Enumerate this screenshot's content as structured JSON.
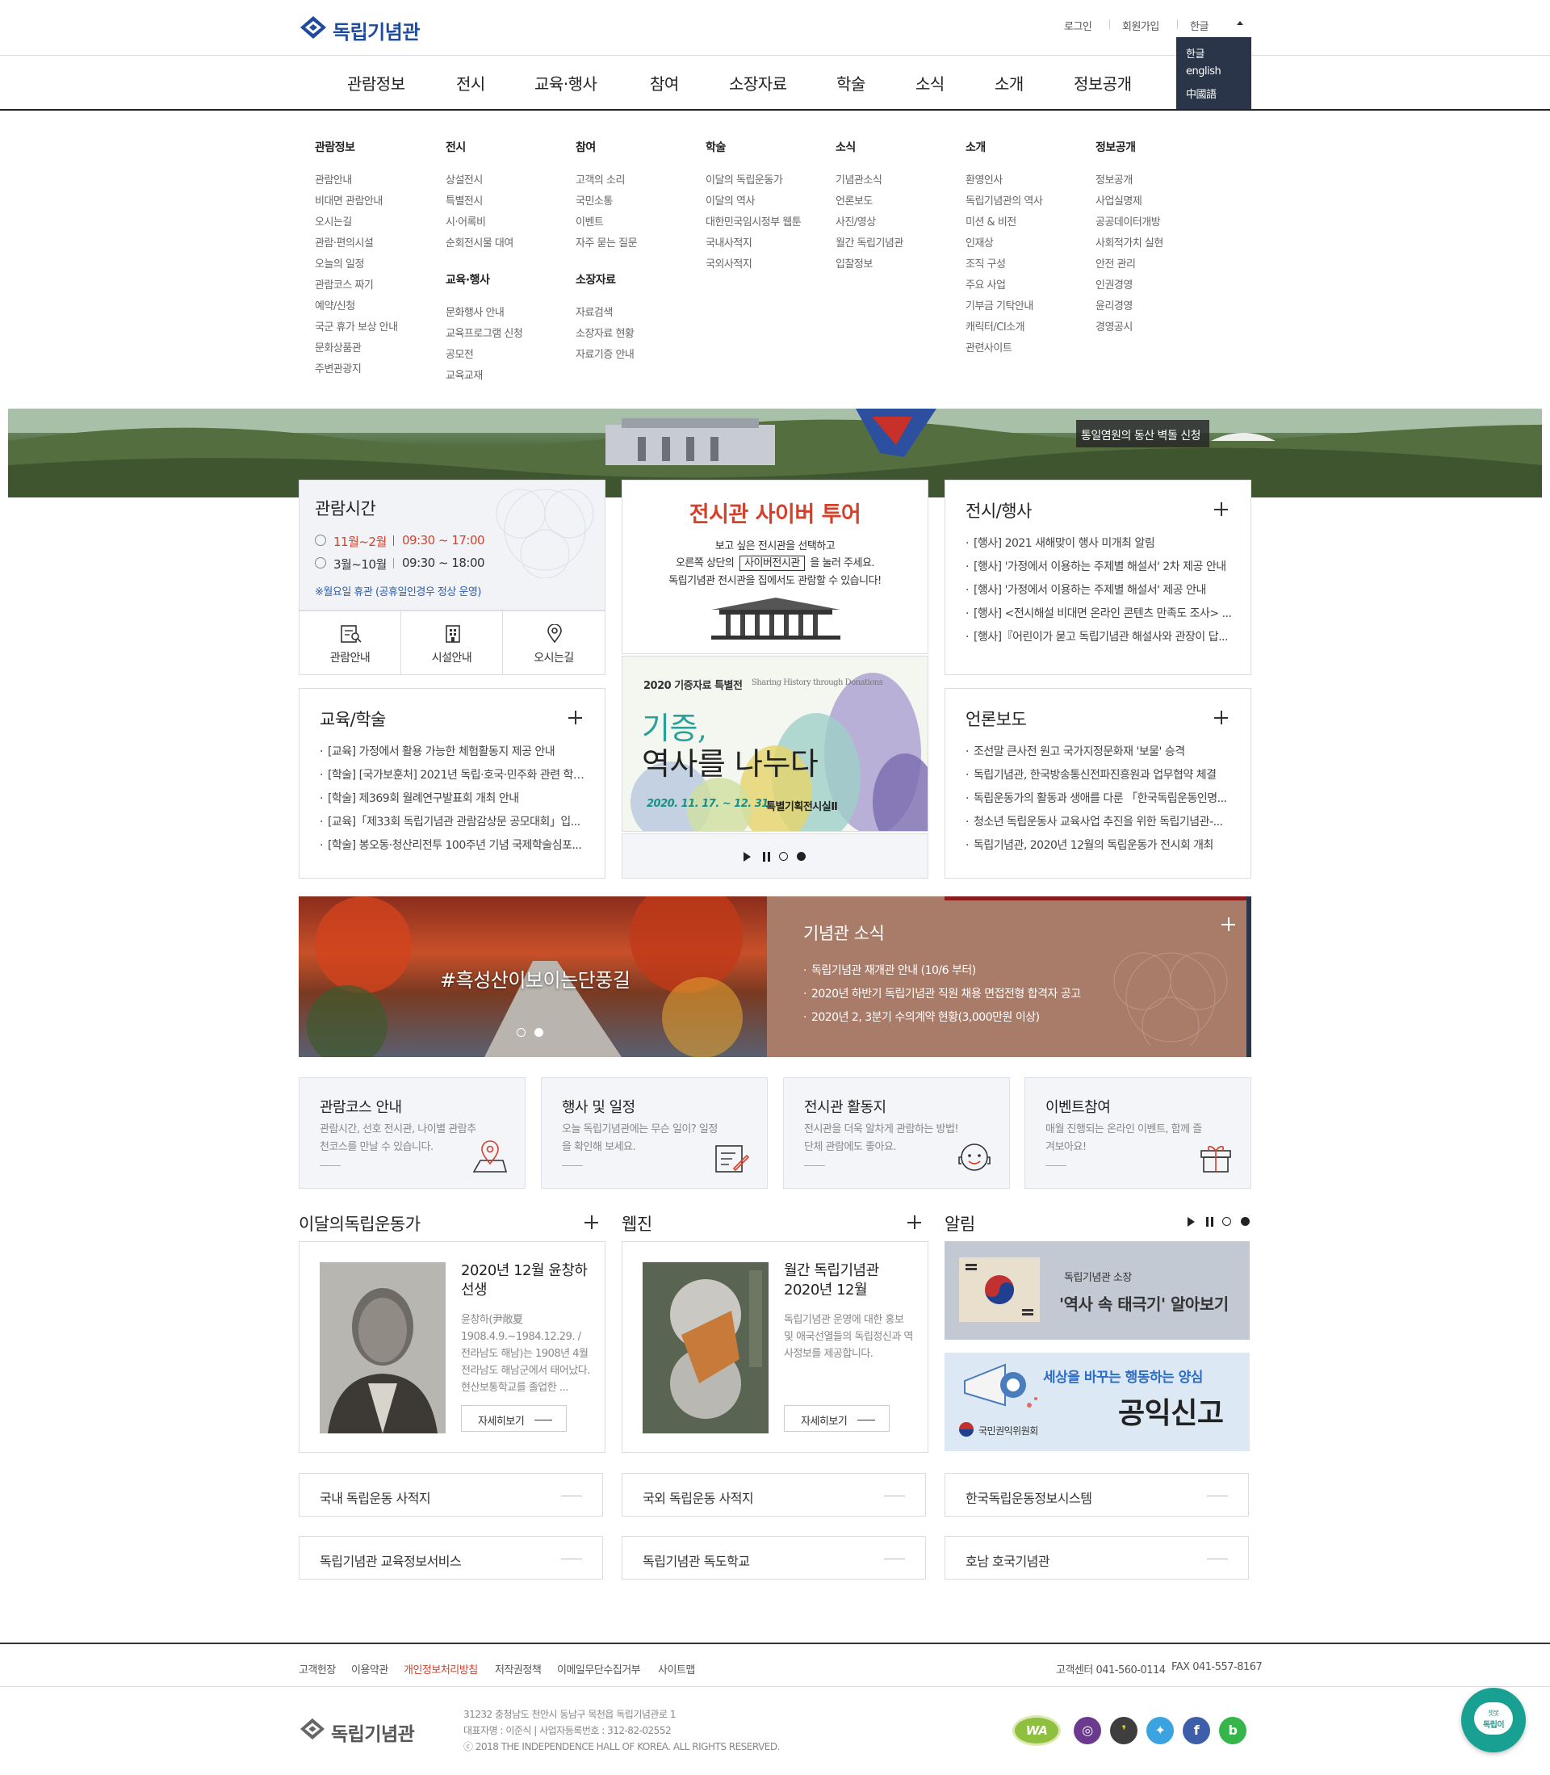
{
  "header": {
    "logo_text": "독립기념관",
    "util": {
      "login": "로그인",
      "join": "회원가입",
      "lang": "한글"
    },
    "lang_options": [
      "한글",
      "english",
      "中國語"
    ],
    "gnb": [
      "관람정보",
      "전시",
      "교육·행사",
      "참여",
      "소장자료",
      "학술",
      "소식",
      "소개",
      "정보공개"
    ]
  },
  "mega_menu": {
    "visit": {
      "title": "관람정보",
      "items": [
        "관람안내",
        "비대면 관람안내",
        "오시는길",
        "관람·편의시설",
        "오늘의 일정",
        "관람코스 짜기",
        "예약/신청",
        "국군 휴가 보상 안내",
        "문화상품관",
        "주변관광지"
      ]
    },
    "exhibit": {
      "title": "전시",
      "items": [
        "상설전시",
        "특별전시",
        "시·어록비",
        "순회전시물 대여"
      ]
    },
    "edu": {
      "title": "교육·행사",
      "items": [
        "문화행사 안내",
        "교육프로그램 신청",
        "공모전",
        "교육교재"
      ]
    },
    "join": {
      "title": "참여",
      "items": [
        "고객의 소리",
        "국민소통",
        "이벤트",
        "자주 묻는 질문"
      ]
    },
    "collection": {
      "title": "소장자료",
      "items": [
        "자료검색",
        "소장자료 현황",
        "자료기증 안내"
      ]
    },
    "academic": {
      "title": "학술",
      "items": [
        "이달의 독립운동가",
        "이달의 역사",
        "대한민국임시정부 웹툰",
        "국내사적지",
        "국외사적지"
      ]
    },
    "news": {
      "title": "소식",
      "items": [
        "기념관소식",
        "언론보도",
        "사진/영상",
        "월간 독립기념관",
        "입찰정보"
      ]
    },
    "about": {
      "title": "소개",
      "items": [
        "환영인사",
        "독립기념관의 역사",
        "미션 & 비전",
        "인재상",
        "조직 구성",
        "주요 사업",
        "기부금 기탁안내",
        "캐릭터/CI소개",
        "관련사이트"
      ]
    },
    "disclosure": {
      "title": "정보공개",
      "items": [
        "정보공개",
        "사업실명제",
        "공공데이터개방",
        "사회적가치 실현",
        "안전 관리",
        "인권경영",
        "윤리경영",
        "경영공시"
      ]
    }
  },
  "hero": {
    "tag": "통일염원의 동산 벽돌 신청"
  },
  "hours": {
    "title": "관람시간",
    "row1_period": "11월~2월",
    "row1_time": "09:30 ~ 17:00",
    "row2_period": "3월~10월",
    "row2_time": "09:30 ~ 18:00",
    "note": "※월요일 휴관 (공휴일인경우 정상 운영)",
    "links": [
      "관람안내",
      "시설안내",
      "오시는길"
    ]
  },
  "cyber": {
    "title": "전시관 사이버 투어",
    "line1": "보고 싶은 전시관을 선택하고",
    "line2_pre": "오른쪽 상단의",
    "line2_btn": "사이버전시관",
    "line2_post": "을 눌러 주세요.",
    "line3": "독립기념관 전시관을 집에서도 관람할 수 있습니다!"
  },
  "special": {
    "label": "2020 기증자료 특별전",
    "label_en": "Sharing History through Donations",
    "big1": "기증,",
    "big2": "역사를 나누다",
    "date": "2020. 11. 17. ~ 12. 31.",
    "hall": "특별기획전시실Ⅱ"
  },
  "exhibit_events": {
    "title": "전시/행사",
    "items": [
      "[행사] 2021 새해맞이 행사 미개최 알림",
      "[행사] '가정에서 이용하는 주제별 해설서' 2차 제공 안내",
      "[행사] '가정에서 이용하는 주제별 해설서' 제공 안내",
      "[행사] <전시해설 비대면 온라인 콘텐츠 만족도 조사> ...",
      "[행사]『어린이가 묻고 독립기념관 해설사와 관장이 답..."
    ]
  },
  "edu_academic": {
    "title": "교육/학술",
    "items": [
      "[교육] 가정에서 활용 가능한 체험활동지 제공 안내",
      "[학술] [국가보훈처] 2021년 독립·호국·민주화 관련 학술...",
      "[학술] 제369회 월례연구발표회 개최 안내",
      "[교육]「제33회 독립기념관 관람감상문 공모대회」입...",
      "[학술] 봉오동·청산리전투 100주년 기념 국제학술심포..."
    ]
  },
  "press": {
    "title": "언론보도",
    "items": [
      "조선말 큰사전 원고 국가지정문화재 '보물' 승격",
      "독립기념관, 한국방송통신전파진흥원과 업무협약 체결",
      "독립운동가의 활동과 생애를 다룬 「한국독립운동인명...",
      "청소년 독립운동사 교육사업 추진을 위한 독립기념관-...",
      "독립기념관, 2020년 12월의 독립운동가 전시회 개최"
    ]
  },
  "photo_banner": {
    "caption": "#흑성산이보이는단풍길"
  },
  "hall_news": {
    "title": "기념관 소식",
    "items": [
      "독립기념관 재개관 안내 (10/6 부터)",
      "2020년 하반기 독립기념관 직원 채용 면접전형 합격자 공고",
      "2020년 2, 3분기 수의계약 현황(3,000만원 이상)"
    ]
  },
  "ctas": [
    {
      "title": "관람코스 안내",
      "desc": "관람시간, 선호 전시관, 나이별 관람추천코스를 만날 수 있습니다."
    },
    {
      "title": "행사 및 일정",
      "desc": "오늘 독립기념관에는 무슨 일이? 일정을 확인해 보세요."
    },
    {
      "title": "전시관 활동지",
      "desc": "전시관을 더욱 알차게 관람하는 방법! 단체 관람에도 좋아요."
    },
    {
      "title": "이벤트참여",
      "desc": "매월 진행되는 온라인 이벤트, 함께 즐겨보아요!"
    }
  ],
  "activist": {
    "section": "이달의독립운동가",
    "title": "2020년 12월 윤창하 선생",
    "desc": "윤창하(尹敞夏 1908.4.9.~1984.12.29. / 전라남도 해남)는 1908년 4월 전라남도 해남군에서 태어났다. 현산보통학교를 졸업한 ...",
    "more": "자세히보기"
  },
  "webzine": {
    "section": "웹진",
    "title": "월간 독립기념관 2020년 12월",
    "desc": "독립기념관 운영에 대한 홍보 및 애국선열들의 독립정신과 역사정보를 제공합니다.",
    "more": "자세히보기"
  },
  "notice": {
    "section": "알림",
    "banner1_small": "독립기념관 소장",
    "banner1_big": "'역사 속 태극기' 알아보기",
    "banner2_small": "세상을 바꾸는 행동하는 양심",
    "banner2_big": "공익신고",
    "banner2_org": "국민권익위원회"
  },
  "quick_links": [
    "국내 독립운동 사적지",
    "국외 독립운동 사적지",
    "한국독립운동정보시스템",
    "독립기념관 교육정보서비스",
    "독립기념관 독도학교",
    "호남 호국기념관"
  ],
  "footer": {
    "links": [
      "고객헌장",
      "이용약관",
      "개인정보처리방침",
      "저작권정책",
      "이메일무단수집거부",
      "사이트맵"
    ],
    "tel": "고객센터 041-560-0114",
    "fax": "FAX 041-557-8167",
    "logo_text": "독립기념관",
    "addr1": "31232 충청남도 천안시 동남구 목천읍 독립기념관로 1",
    "addr2": "대표자명 : 이준식 | 사업자등록번호 : 312-82-02552",
    "copy": "ⓒ 2018 THE INDEPENDENCE HALL OF KOREA. ALL RIGHTS RESERVED.",
    "chat_top": "챗봇",
    "chat_bot": "독립이",
    "wa": "WA"
  },
  "colors": {
    "accent_red": "#d4402a",
    "navy": "#2a3549",
    "brown": "#a97b69",
    "logo_blue": "#1f4b9e"
  }
}
